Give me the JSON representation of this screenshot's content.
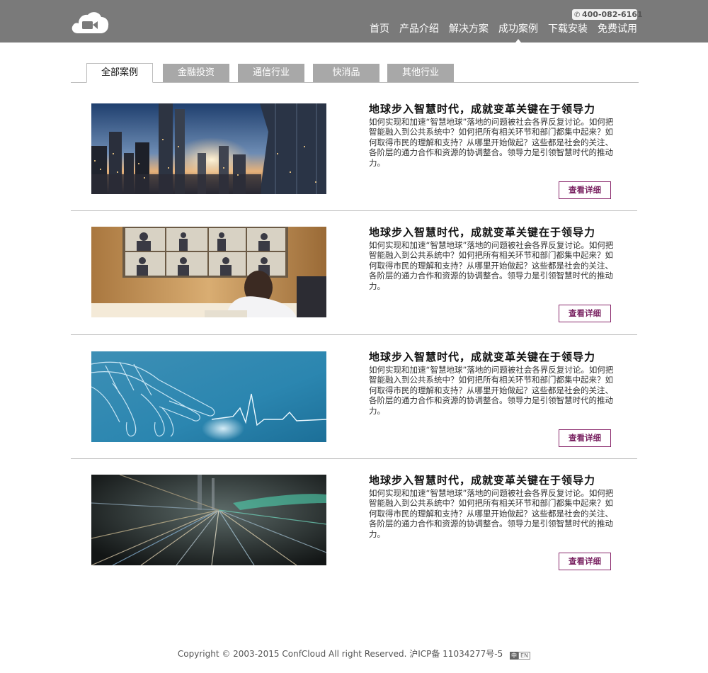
{
  "header": {
    "phone": "400-082-6161",
    "nav": [
      "首页",
      "产品介绍",
      "解决方案",
      "成功案例",
      "下载安装",
      "免费试用"
    ],
    "active_index": 3
  },
  "tabs": [
    "全部案例",
    "金融投资",
    "通信行业",
    "快消品",
    "其他行业"
  ],
  "cases": [
    {
      "title": "地球步入智慧时代，成就变革关键在于领导力",
      "desc": "如何实现和加速“智慧地球”落地的问题被社会各界反复讨论。如何把智能融入到公共系统中？如何把所有相关环节和部门都集中起来？如何取得市民的理解和支持？从哪里开始做起？这些都是社会的关注、各阶层的通力合作和资源的协调整合。领导力是引领智慧时代的推动力。",
      "button": "查看详细",
      "image": "city-skyline-photo"
    },
    {
      "title": "地球步入智慧时代，成就变革关键在于领导力",
      "desc": "如何实现和加速“智慧地球”落地的问题被社会各界反复讨论。如何把智能融入到公共系统中？如何把所有相关环节和部门都集中起来？如何取得市民的理解和支持？从哪里开始做起？这些都是社会的关注、各阶层的通力合作和资源的协调整合。领导力是引领智慧时代的推动力。",
      "button": "查看详细",
      "image": "video-conference-photo"
    },
    {
      "title": "地球步入智慧时代，成就变革关键在于领导力",
      "desc": "如何实现和加速“智慧地球”落地的问题被社会各界反复讨论。如何把智能融入到公共系统中？如何把所有相关环节和部门都集中起来？如何取得市民的理解和支持？从哪里开始做起？这些都是社会的关注、各阶层的通力合作和资源的协调整合。领导力是引领智慧时代的推动力。",
      "button": "查看详细",
      "image": "digital-hand-photo"
    },
    {
      "title": "地球步入智慧时代，成就变革关键在于领导力",
      "desc": "如何实现和加速“智慧地球”落地的问题被社会各界反复讨论。如何把智能融入到公共系统中？如何把所有相关环节和部门都集中起来？如何取得市民的理解和支持？从哪里开始做起？这些都是社会的关注、各阶层的通力合作和资源的协调整合。领导力是引领智慧时代的推动力。",
      "button": "查看详细",
      "image": "light-speed-city-photo"
    }
  ],
  "footer": {
    "copyright": "Copyright © 2003-2015 ConfCloud All right Reserved. 沪ICP备 11034277号-5",
    "lang_zh": "中",
    "lang_en": "EN"
  },
  "icons": {
    "logo": "cloud-video-camera-icon",
    "phone": "phone-icon"
  },
  "colors": {
    "header_bg": "#7a7a7a",
    "tab_inactive_bg": "#a8a8a8",
    "button_border": "#8a2a6d"
  }
}
